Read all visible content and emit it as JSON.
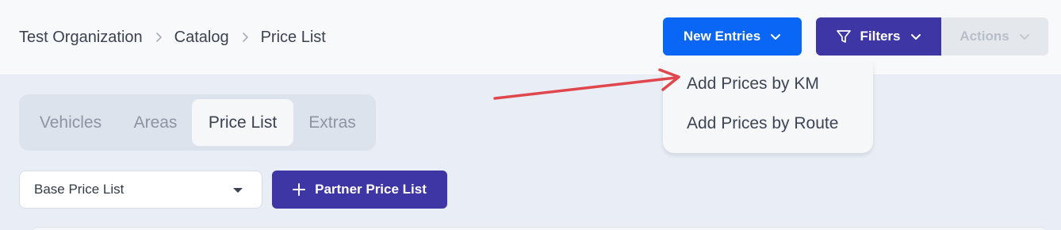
{
  "breadcrumb": {
    "items": [
      "Test Organization",
      "Catalog",
      "Price List"
    ]
  },
  "header": {
    "new_entries_label": "New Entries",
    "filters_label": "Filters",
    "actions_label": "Actions"
  },
  "new_entries_menu": {
    "items": [
      "Add Prices by KM",
      "Add Prices by Route"
    ]
  },
  "tabs": {
    "items": [
      "Vehicles",
      "Areas",
      "Price List",
      "Extras"
    ],
    "active": "Price List"
  },
  "price_list_select": {
    "value": "Base Price List"
  },
  "partner_button": {
    "label": "Partner Price List"
  },
  "icons": {
    "breadcrumb_separator": "chevron-right-icon",
    "new_entries": "chevron-down-icon",
    "filters": "funnel-icon",
    "partner": "plus-icon",
    "annotation": "red-arrow"
  },
  "colors": {
    "primary_blue": "#0a66f5",
    "primary_indigo": "#3f36a5",
    "annotation_red": "#e0474c"
  }
}
